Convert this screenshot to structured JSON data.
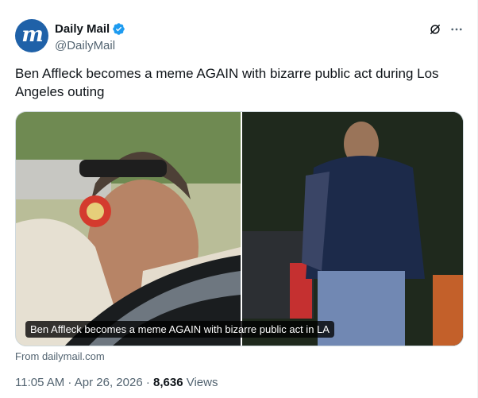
{
  "account": {
    "name": "Daily Mail",
    "handle": "@DailyMail",
    "avatar_letter": "m",
    "verified": true
  },
  "icons": {
    "grok": "grok-icon",
    "more": "more-icon",
    "verified": "verified-badge-icon"
  },
  "tweet": {
    "text": "Ben Affleck becomes a meme AGAIN with bizarre public act during Los Angeles outing"
  },
  "media": {
    "caption": "Ben Affleck becomes a meme AGAIN with bizarre public act in LA",
    "source": "From dailymail.com"
  },
  "meta": {
    "time": "11:05 AM",
    "separator": " · ",
    "date": "Apr 26, 2026",
    "views_count": "8,636",
    "views_label": " Views"
  },
  "colors": {
    "brand": "#1f61a8",
    "verified": "#1d9bf0",
    "text": "#0f1419",
    "secondary": "#536471"
  }
}
